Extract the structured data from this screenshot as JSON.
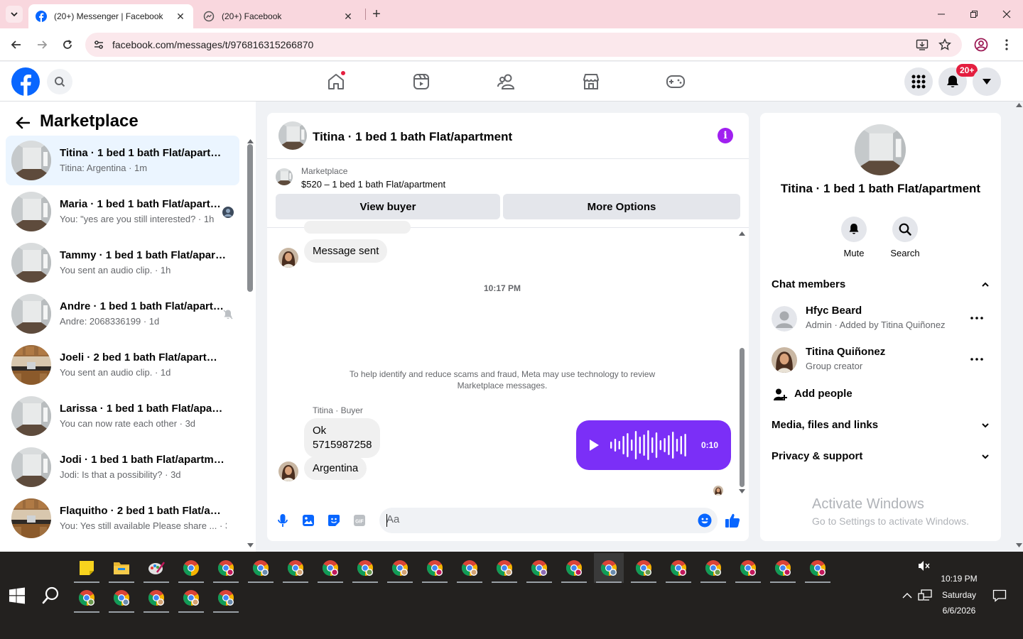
{
  "browser": {
    "tabs": [
      {
        "title": "(20+) Messenger | Facebook",
        "active": true
      },
      {
        "title": "(20+) Facebook",
        "active": false
      }
    ],
    "url": "facebook.com/messages/t/976816315266870"
  },
  "fb_nav": {
    "notification_count": "20+",
    "icons": [
      "home-icon",
      "video-icon",
      "friends-icon",
      "marketplace-icon",
      "gaming-icon"
    ]
  },
  "sidebar": {
    "title": "Marketplace",
    "conversations": [
      {
        "name": "Titina · 1 bed 1 bath Flat/apartment",
        "preview": "Titina: Argentina · 1m",
        "active": true,
        "photo": "empty-room"
      },
      {
        "name": "Maria · 1 bed 1 bath Flat/apartment",
        "preview": "You: \"yes are you still interested? · 1h",
        "photo": "empty-room",
        "indicator": "seen-avatar"
      },
      {
        "name": "Tammy · 1 bed 1 bath Flat/apartment",
        "preview": "You sent an audio clip. · 1h",
        "photo": "empty-room"
      },
      {
        "name": "Andre · 1 bed 1 bath Flat/apartment",
        "preview": "Andre: 2068336199 · 1d",
        "photo": "empty-room",
        "indicator": "muted-bell"
      },
      {
        "name": "Joeli · 2 bed 1 bath Flat/apartment",
        "preview": "You sent an audio clip. · 1d",
        "photo": "kitchen"
      },
      {
        "name": "Larissa · 1 bed 1 bath Flat/apartment",
        "preview": "You can now rate each other · 3d",
        "photo": "empty-room"
      },
      {
        "name": "Jodi · 1 bed 1 bath Flat/apartment",
        "preview": "Jodi: Is that a possibility? · 3d",
        "photo": "empty-room"
      },
      {
        "name": "Flaquitho · 2 bed 1 bath Flat/apartment",
        "preview": "You: Yes still available Please share ... · 3d",
        "photo": "kitchen"
      }
    ]
  },
  "chat": {
    "title": "Titina · 1 bed 1 bath Flat/apartment",
    "marketplace_label": "Marketplace",
    "listing": "$520 – 1 bed 1 bath Flat/apartment",
    "view_buyer": "View buyer",
    "more_options": "More Options",
    "messages": {
      "message_sent": "Message sent",
      "timestamp": "10:17 PM",
      "audio_duration": "0:10",
      "notice": "To help identify and reduce scams and fraud, Meta may use technology to review Marketplace messages.",
      "sender_label": "Titina · Buyer",
      "ok_line1": "Ok",
      "ok_line2": "5715987258",
      "argentina": "Argentina"
    },
    "composer_placeholder": "Aa"
  },
  "details": {
    "title": "Titina · 1 bed 1 bath Flat/apartment",
    "mute": "Mute",
    "search": "Search",
    "chat_members": "Chat members",
    "members": [
      {
        "name": "Hfyc Beard",
        "role": "Admin · Added by Titina Quiñonez"
      },
      {
        "name": "Titina Quiñonez",
        "role": "Group creator"
      }
    ],
    "add_people": "Add people",
    "media": "Media, files and links",
    "privacy": "Privacy & support",
    "watermark_title": "Activate Windows",
    "watermark_sub": "Go to Settings to activate Windows."
  },
  "taskbar": {
    "time": "10:19 PM",
    "day": "Saturday",
    "date": "6/6/2026"
  },
  "colors": {
    "fb_blue": "#0866ff",
    "messenger_purple": "#7b2ff7",
    "badge_red": "#e41e3f",
    "tab_strip": "#f9d7de"
  }
}
